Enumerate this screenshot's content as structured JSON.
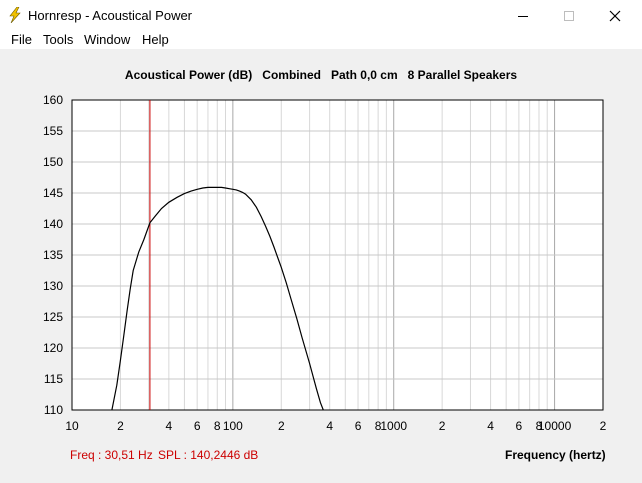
{
  "window": {
    "title": "Hornresp - Acoustical Power",
    "icon": "lightning-bolt-icon",
    "controls": [
      "minimize-icon",
      "maximize-icon",
      "close-icon"
    ]
  },
  "menu": {
    "items": [
      "File",
      "Tools",
      "Window",
      "Help"
    ]
  },
  "plot": {
    "title": "Acoustical Power (dB)   Combined   Path 0,0 cm   8 Parallel Speakers",
    "status_freq": "Freq : 30,51 Hz",
    "status_spl": "SPL : 140,2446 dB",
    "xlabel": "Frequency (hertz)"
  },
  "colors": {
    "curve": "#000000",
    "cursor": "#cc0000",
    "grid": "#c8c8c8",
    "status_text": "#cc0000"
  },
  "chart_data": {
    "type": "line",
    "title": "Acoustical Power (dB)   Combined   Path 0,0 cm   8 Parallel Speakers",
    "xlabel": "Frequency (hertz)",
    "ylabel": "",
    "xscale": "log",
    "xlim": [
      10,
      20000
    ],
    "ylim": [
      110,
      160
    ],
    "yticks": [
      110,
      115,
      120,
      125,
      130,
      135,
      140,
      145,
      150,
      155,
      160
    ],
    "xtick_labels": [
      {
        "value": 10,
        "label": "10"
      },
      {
        "value": 20,
        "label": "2"
      },
      {
        "value": 40,
        "label": "4"
      },
      {
        "value": 60,
        "label": "6"
      },
      {
        "value": 80,
        "label": "8"
      },
      {
        "value": 100,
        "label": "100"
      },
      {
        "value": 200,
        "label": "2"
      },
      {
        "value": 400,
        "label": "4"
      },
      {
        "value": 600,
        "label": "6"
      },
      {
        "value": 800,
        "label": "8"
      },
      {
        "value": 1000,
        "label": "1000"
      },
      {
        "value": 2000,
        "label": "2"
      },
      {
        "value": 4000,
        "label": "4"
      },
      {
        "value": 6000,
        "label": "6"
      },
      {
        "value": 8000,
        "label": "8"
      },
      {
        "value": 10000,
        "label": "10000"
      },
      {
        "value": 20000,
        "label": "2"
      }
    ],
    "grid": true,
    "cursor_x": 30.51,
    "series": [
      {
        "x": [
          17.7,
          19,
          20,
          21,
          22,
          23,
          24,
          26,
          28,
          30.51,
          33,
          36,
          40,
          45,
          50,
          55,
          60,
          65,
          70,
          75,
          80,
          85,
          90,
          95,
          100,
          105,
          110,
          115,
          120,
          130,
          140,
          150,
          160,
          170,
          180,
          190,
          200,
          215,
          230,
          250,
          270,
          300,
          330,
          350,
          365
        ],
        "y": [
          110,
          114,
          118,
          122,
          126,
          129.5,
          132.5,
          135.5,
          137.5,
          140.2,
          141.3,
          142.5,
          143.5,
          144.3,
          144.9,
          145.3,
          145.6,
          145.8,
          145.9,
          145.9,
          145.9,
          145.9,
          145.8,
          145.7,
          145.6,
          145.5,
          145.3,
          145.1,
          144.8,
          143.9,
          142.7,
          141.2,
          139.6,
          138,
          136.3,
          134.6,
          133,
          130.5,
          127.9,
          124.7,
          121.6,
          117.5,
          113.5,
          111.2,
          110
        ]
      }
    ]
  }
}
